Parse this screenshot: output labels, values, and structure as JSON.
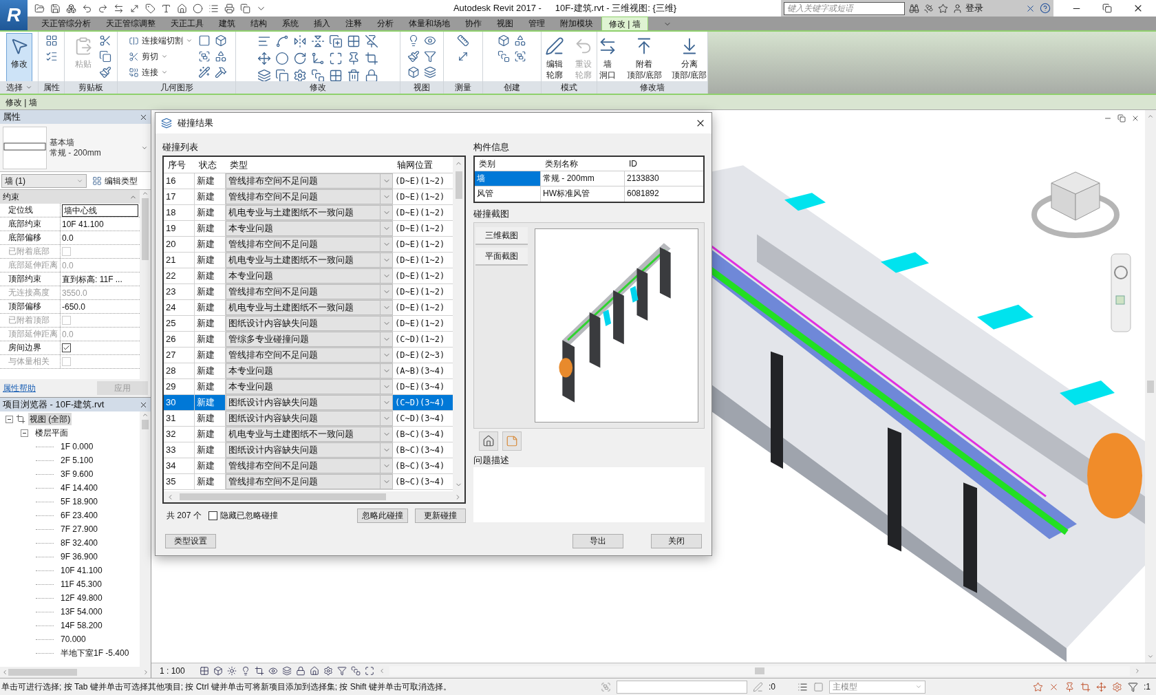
{
  "title_bar": {
    "app_logo": "R",
    "app_name": "Autodesk Revit 2017 -",
    "document": "10F-建筑.rvt - 三维视图: {三维}",
    "search": {
      "placeholder": "键入关键字或短语"
    },
    "sign_in": "登录"
  },
  "ribbon_tabs": [
    {
      "label": "天正管综分析",
      "selected": false
    },
    {
      "label": "天正管综调整",
      "selected": false
    },
    {
      "label": "天正工具",
      "selected": false
    },
    {
      "label": "建筑",
      "selected": false
    },
    {
      "label": "结构",
      "selected": false
    },
    {
      "label": "系统",
      "selected": false
    },
    {
      "label": "插入",
      "selected": false
    },
    {
      "label": "注释",
      "selected": false
    },
    {
      "label": "分析",
      "selected": false
    },
    {
      "label": "体量和场地",
      "selected": false
    },
    {
      "label": "协作",
      "selected": false
    },
    {
      "label": "视图",
      "selected": false
    },
    {
      "label": "管理",
      "selected": false
    },
    {
      "label": "附加模块",
      "selected": false
    },
    {
      "label": "修改 | 墙",
      "selected": true
    }
  ],
  "ribbon_panels": [
    {
      "label": "选择",
      "dropdown": true,
      "tools": [
        {
          "kind": "large",
          "lines": [
            "修改"
          ],
          "selected": true,
          "disabled": false
        }
      ]
    },
    {
      "label": "属性"
    },
    {
      "label": "剪贴板",
      "tools": [
        {
          "kind": "large",
          "lines": [
            "粘贴"
          ],
          "selected": false,
          "disabled": true
        }
      ]
    },
    {
      "label": "几何图形",
      "tools": [
        {
          "kind": "small",
          "lines": [
            "连接端切割"
          ],
          "selected": false,
          "disabled": false
        },
        {
          "kind": "small",
          "lines": [
            "剪切"
          ],
          "selected": false,
          "disabled": false
        },
        {
          "kind": "small",
          "lines": [
            "连接"
          ],
          "selected": false,
          "disabled": false
        }
      ]
    },
    {
      "label": "修改"
    },
    {
      "label": "视图"
    },
    {
      "label": "测量"
    },
    {
      "label": "创建"
    },
    {
      "label": "模式",
      "tools": [
        {
          "kind": "large",
          "lines": [
            "编辑",
            "轮廓"
          ],
          "selected": false,
          "disabled": false
        },
        {
          "kind": "large",
          "lines": [
            "重设",
            "轮廓"
          ],
          "selected": false,
          "disabled": true
        }
      ]
    },
    {
      "label": "修改墙",
      "tools": [
        {
          "kind": "large",
          "lines": [
            "墙",
            "洞口"
          ],
          "selected": false,
          "disabled": false
        },
        {
          "kind": "large",
          "lines": [
            "附着",
            "顶部/底部"
          ],
          "selected": false,
          "disabled": false
        },
        {
          "kind": "large",
          "lines": [
            "分离",
            "顶部/底部"
          ],
          "selected": false,
          "disabled": false
        }
      ]
    }
  ],
  "options_bar": {
    "context": "修改 | 墙"
  },
  "properties": {
    "title": "属性",
    "family": "基本墙",
    "type": "常规 - 200mm",
    "instance_filter": "墙 (1)",
    "edit_type": "编辑类型",
    "group": "约束",
    "rows": [
      {
        "label": "定位线",
        "value": "墙中心线",
        "kind": "edit",
        "disabled": false
      },
      {
        "label": "底部约束",
        "value": "10F 41.100",
        "kind": "text",
        "disabled": false
      },
      {
        "label": "底部偏移",
        "value": "0.0",
        "kind": "text",
        "disabled": false
      },
      {
        "label": "已附着底部",
        "kind": "check",
        "checked": false,
        "disabled": true
      },
      {
        "label": "底部延伸距离",
        "value": "0.0",
        "kind": "text",
        "disabled": true
      },
      {
        "label": "顶部约束",
        "value": "直到标高: 11F ...",
        "kind": "text",
        "disabled": false
      },
      {
        "label": "无连接高度",
        "value": "3550.0",
        "kind": "text",
        "disabled": true
      },
      {
        "label": "顶部偏移",
        "value": "-650.0",
        "kind": "text",
        "disabled": false
      },
      {
        "label": "已附着顶部",
        "kind": "check",
        "checked": false,
        "disabled": true
      },
      {
        "label": "顶部延伸距离",
        "value": "0.0",
        "kind": "text",
        "disabled": true
      },
      {
        "label": "房间边界",
        "kind": "check",
        "checked": true,
        "disabled": false
      },
      {
        "label": "与体量相关",
        "kind": "check",
        "checked": false,
        "disabled": true
      }
    ],
    "help_link": "属性帮助",
    "apply": "应用"
  },
  "browser": {
    "title": "项目浏览器 - 10F-建筑.rvt",
    "tree": [
      {
        "label": "视图 (全部)",
        "expanded": true,
        "selected": true,
        "children": [
          {
            "label": "楼层平面",
            "expanded": true,
            "selected": false,
            "children": [
              {
                "label": "1F 0.000",
                "selected": false
              },
              {
                "label": "2F 5.100",
                "selected": false
              },
              {
                "label": "3F 9.600",
                "selected": false
              },
              {
                "label": "4F 14.400",
                "selected": false
              },
              {
                "label": "5F 18.900",
                "selected": false
              },
              {
                "label": "6F 23.400",
                "selected": false
              },
              {
                "label": "7F 27.900",
                "selected": false
              },
              {
                "label": "8F 32.400",
                "selected": false
              },
              {
                "label": "9F 36.900",
                "selected": false
              },
              {
                "label": "10F 41.100",
                "selected": false
              },
              {
                "label": "11F 45.300",
                "selected": false
              },
              {
                "label": "12F 49.800",
                "selected": false
              },
              {
                "label": "13F 54.000",
                "selected": false
              },
              {
                "label": "14F 58.200",
                "selected": false
              },
              {
                "label": "70.000",
                "selected": false
              },
              {
                "label": "半地下室1F -5.400",
                "selected": false
              }
            ]
          }
        ]
      }
    ]
  },
  "dialog": {
    "title": "碰撞结果",
    "list_label": "碰撞列表",
    "columns": [
      "序号",
      "状态",
      "类型",
      "轴网位置"
    ],
    "rows": [
      {
        "no": "16",
        "status": "新建",
        "type": "管线排布空间不足问题",
        "grid": "(D~E)(1~2)",
        "selected": false
      },
      {
        "no": "17",
        "status": "新建",
        "type": "管线排布空间不足问题",
        "grid": "(D~E)(1~2)",
        "selected": false
      },
      {
        "no": "18",
        "status": "新建",
        "type": "机电专业与土建图纸不一致问题",
        "grid": "(D~E)(1~2)",
        "selected": false
      },
      {
        "no": "19",
        "status": "新建",
        "type": "本专业问题",
        "grid": "(D~E)(1~2)",
        "selected": false
      },
      {
        "no": "20",
        "status": "新建",
        "type": "管线排布空间不足问题",
        "grid": "(D~E)(1~2)",
        "selected": false
      },
      {
        "no": "21",
        "status": "新建",
        "type": "机电专业与土建图纸不一致问题",
        "grid": "(D~E)(1~2)",
        "selected": false
      },
      {
        "no": "22",
        "status": "新建",
        "type": "本专业问题",
        "grid": "(D~E)(1~2)",
        "selected": false
      },
      {
        "no": "23",
        "status": "新建",
        "type": "管线排布空间不足问题",
        "grid": "(D~E)(1~2)",
        "selected": false
      },
      {
        "no": "24",
        "status": "新建",
        "type": "机电专业与土建图纸不一致问题",
        "grid": "(D~E)(1~2)",
        "selected": false
      },
      {
        "no": "25",
        "status": "新建",
        "type": "图纸设计内容缺失问题",
        "grid": "(D~E)(1~2)",
        "selected": false
      },
      {
        "no": "26",
        "status": "新建",
        "type": "管综多专业碰撞问题",
        "grid": "(C~D)(1~2)",
        "selected": false
      },
      {
        "no": "27",
        "status": "新建",
        "type": "管线排布空间不足问题",
        "grid": "(D~E)(2~3)",
        "selected": false
      },
      {
        "no": "28",
        "status": "新建",
        "type": "本专业问题",
        "grid": "(A~B)(3~4)",
        "selected": false
      },
      {
        "no": "29",
        "status": "新建",
        "type": "本专业问题",
        "grid": "(D~E)(3~4)",
        "selected": false
      },
      {
        "no": "30",
        "status": "新建",
        "type": "图纸设计内容缺失问题",
        "grid": "(C~D)(3~4)",
        "selected": true
      },
      {
        "no": "31",
        "status": "新建",
        "type": "图纸设计内容缺失问题",
        "grid": "(C~D)(3~4)",
        "selected": false
      },
      {
        "no": "32",
        "status": "新建",
        "type": "机电专业与土建图纸不一致问题",
        "grid": "(B~C)(3~4)",
        "selected": false
      },
      {
        "no": "33",
        "status": "新建",
        "type": "图纸设计内容缺失问题",
        "grid": "(B~C)(3~4)",
        "selected": false
      },
      {
        "no": "34",
        "status": "新建",
        "type": "管线排布空间不足问题",
        "grid": "(B~C)(3~4)",
        "selected": false
      },
      {
        "no": "35",
        "status": "新建",
        "type": "管线排布空间不足问题",
        "grid": "(B~C)(3~4)",
        "selected": false
      }
    ],
    "total": "共 207 个",
    "hide_ignored": {
      "label": "隐藏已忽略碰撞",
      "checked": false
    },
    "ignore_button": "忽略此碰撞",
    "update_button": "更新碰撞",
    "info_label": "构件信息",
    "info_columns": [
      "类别",
      "类别名称",
      "ID"
    ],
    "info_rows": [
      {
        "category": "墙",
        "name": "常规 - 200mm",
        "id": "2133830",
        "selected": true
      },
      {
        "category": "风管",
        "name": "HW标准风管",
        "id": "6081892",
        "selected": false
      }
    ],
    "snapshot_label": "碰撞截图",
    "snapshot_tabs": [
      "三维截图",
      "平面截图"
    ],
    "description_label": "问题描述",
    "type_settings_button": "类型设置",
    "export_button": "导出",
    "close_button": "关闭"
  },
  "view_bar": {
    "scale": "1 : 100"
  },
  "status_bar": {
    "message": "单击可进行选择; 按 Tab 键并单击可选择其他项目; 按 Ctrl 键并单击可将新项目添加到选择集; 按 Shift 键并单击可取消选择。",
    "worksets_count": ":0",
    "model": "主模型",
    "filter_count": ":1"
  }
}
